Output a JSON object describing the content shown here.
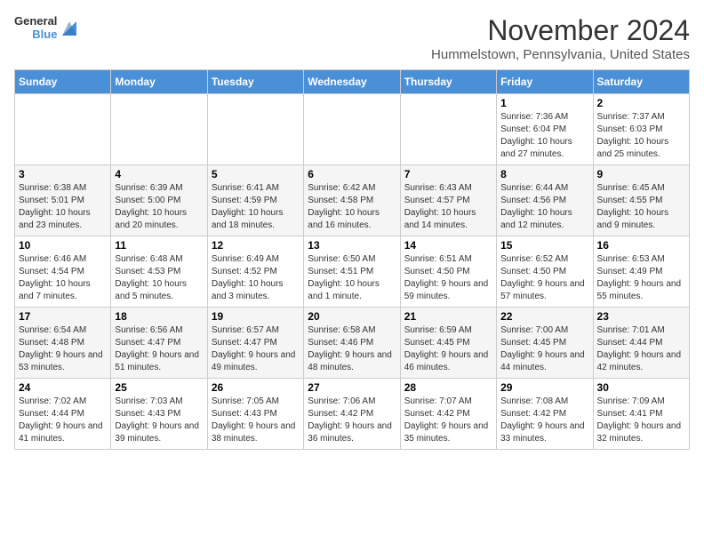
{
  "header": {
    "logo_general": "General",
    "logo_blue": "Blue",
    "title": "November 2024",
    "subtitle": "Hummelstown, Pennsylvania, United States"
  },
  "weekdays": [
    "Sunday",
    "Monday",
    "Tuesday",
    "Wednesday",
    "Thursday",
    "Friday",
    "Saturday"
  ],
  "weeks": [
    [
      {
        "day": "",
        "info": ""
      },
      {
        "day": "",
        "info": ""
      },
      {
        "day": "",
        "info": ""
      },
      {
        "day": "",
        "info": ""
      },
      {
        "day": "",
        "info": ""
      },
      {
        "day": "1",
        "info": "Sunrise: 7:36 AM\nSunset: 6:04 PM\nDaylight: 10 hours and 27 minutes."
      },
      {
        "day": "2",
        "info": "Sunrise: 7:37 AM\nSunset: 6:03 PM\nDaylight: 10 hours and 25 minutes."
      }
    ],
    [
      {
        "day": "3",
        "info": "Sunrise: 6:38 AM\nSunset: 5:01 PM\nDaylight: 10 hours and 23 minutes."
      },
      {
        "day": "4",
        "info": "Sunrise: 6:39 AM\nSunset: 5:00 PM\nDaylight: 10 hours and 20 minutes."
      },
      {
        "day": "5",
        "info": "Sunrise: 6:41 AM\nSunset: 4:59 PM\nDaylight: 10 hours and 18 minutes."
      },
      {
        "day": "6",
        "info": "Sunrise: 6:42 AM\nSunset: 4:58 PM\nDaylight: 10 hours and 16 minutes."
      },
      {
        "day": "7",
        "info": "Sunrise: 6:43 AM\nSunset: 4:57 PM\nDaylight: 10 hours and 14 minutes."
      },
      {
        "day": "8",
        "info": "Sunrise: 6:44 AM\nSunset: 4:56 PM\nDaylight: 10 hours and 12 minutes."
      },
      {
        "day": "9",
        "info": "Sunrise: 6:45 AM\nSunset: 4:55 PM\nDaylight: 10 hours and 9 minutes."
      }
    ],
    [
      {
        "day": "10",
        "info": "Sunrise: 6:46 AM\nSunset: 4:54 PM\nDaylight: 10 hours and 7 minutes."
      },
      {
        "day": "11",
        "info": "Sunrise: 6:48 AM\nSunset: 4:53 PM\nDaylight: 10 hours and 5 minutes."
      },
      {
        "day": "12",
        "info": "Sunrise: 6:49 AM\nSunset: 4:52 PM\nDaylight: 10 hours and 3 minutes."
      },
      {
        "day": "13",
        "info": "Sunrise: 6:50 AM\nSunset: 4:51 PM\nDaylight: 10 hours and 1 minute."
      },
      {
        "day": "14",
        "info": "Sunrise: 6:51 AM\nSunset: 4:50 PM\nDaylight: 9 hours and 59 minutes."
      },
      {
        "day": "15",
        "info": "Sunrise: 6:52 AM\nSunset: 4:50 PM\nDaylight: 9 hours and 57 minutes."
      },
      {
        "day": "16",
        "info": "Sunrise: 6:53 AM\nSunset: 4:49 PM\nDaylight: 9 hours and 55 minutes."
      }
    ],
    [
      {
        "day": "17",
        "info": "Sunrise: 6:54 AM\nSunset: 4:48 PM\nDaylight: 9 hours and 53 minutes."
      },
      {
        "day": "18",
        "info": "Sunrise: 6:56 AM\nSunset: 4:47 PM\nDaylight: 9 hours and 51 minutes."
      },
      {
        "day": "19",
        "info": "Sunrise: 6:57 AM\nSunset: 4:47 PM\nDaylight: 9 hours and 49 minutes."
      },
      {
        "day": "20",
        "info": "Sunrise: 6:58 AM\nSunset: 4:46 PM\nDaylight: 9 hours and 48 minutes."
      },
      {
        "day": "21",
        "info": "Sunrise: 6:59 AM\nSunset: 4:45 PM\nDaylight: 9 hours and 46 minutes."
      },
      {
        "day": "22",
        "info": "Sunrise: 7:00 AM\nSunset: 4:45 PM\nDaylight: 9 hours and 44 minutes."
      },
      {
        "day": "23",
        "info": "Sunrise: 7:01 AM\nSunset: 4:44 PM\nDaylight: 9 hours and 42 minutes."
      }
    ],
    [
      {
        "day": "24",
        "info": "Sunrise: 7:02 AM\nSunset: 4:44 PM\nDaylight: 9 hours and 41 minutes."
      },
      {
        "day": "25",
        "info": "Sunrise: 7:03 AM\nSunset: 4:43 PM\nDaylight: 9 hours and 39 minutes."
      },
      {
        "day": "26",
        "info": "Sunrise: 7:05 AM\nSunset: 4:43 PM\nDaylight: 9 hours and 38 minutes."
      },
      {
        "day": "27",
        "info": "Sunrise: 7:06 AM\nSunset: 4:42 PM\nDaylight: 9 hours and 36 minutes."
      },
      {
        "day": "28",
        "info": "Sunrise: 7:07 AM\nSunset: 4:42 PM\nDaylight: 9 hours and 35 minutes."
      },
      {
        "day": "29",
        "info": "Sunrise: 7:08 AM\nSunset: 4:42 PM\nDaylight: 9 hours and 33 minutes."
      },
      {
        "day": "30",
        "info": "Sunrise: 7:09 AM\nSunset: 4:41 PM\nDaylight: 9 hours and 32 minutes."
      }
    ]
  ]
}
